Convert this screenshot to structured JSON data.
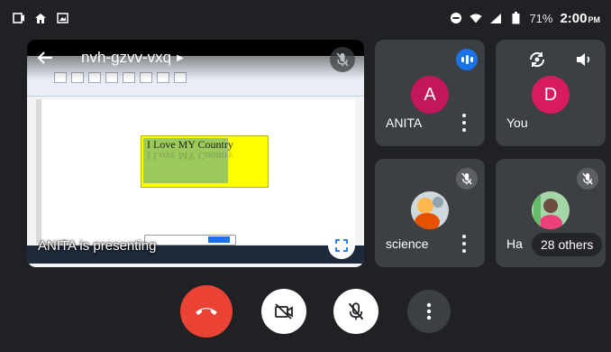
{
  "status_bar": {
    "battery": "71%",
    "time": "2:00",
    "ampm": "PM",
    "icons": [
      "screen-record-icon",
      "home-icon",
      "gallery-icon",
      "dnd-icon",
      "wifi-icon",
      "signal-icon",
      "battery-icon"
    ]
  },
  "main": {
    "meeting_code": "nvh-gzvv-vxq",
    "presenting_text": "ANITA is presenting",
    "document_text": "I Love MY Country"
  },
  "participants": [
    {
      "name": "ANITA",
      "initial": "A",
      "color": "#c2185b"
    },
    {
      "name": "You",
      "initial": "D",
      "color": "#d81b60"
    },
    {
      "name": "science"
    },
    {
      "name": "Ha",
      "others_label": "28 others"
    }
  ],
  "colors": {
    "background": "#202124",
    "tile": "#3c4043",
    "end_call": "#ea4335",
    "speaking": "#1a73e8"
  }
}
